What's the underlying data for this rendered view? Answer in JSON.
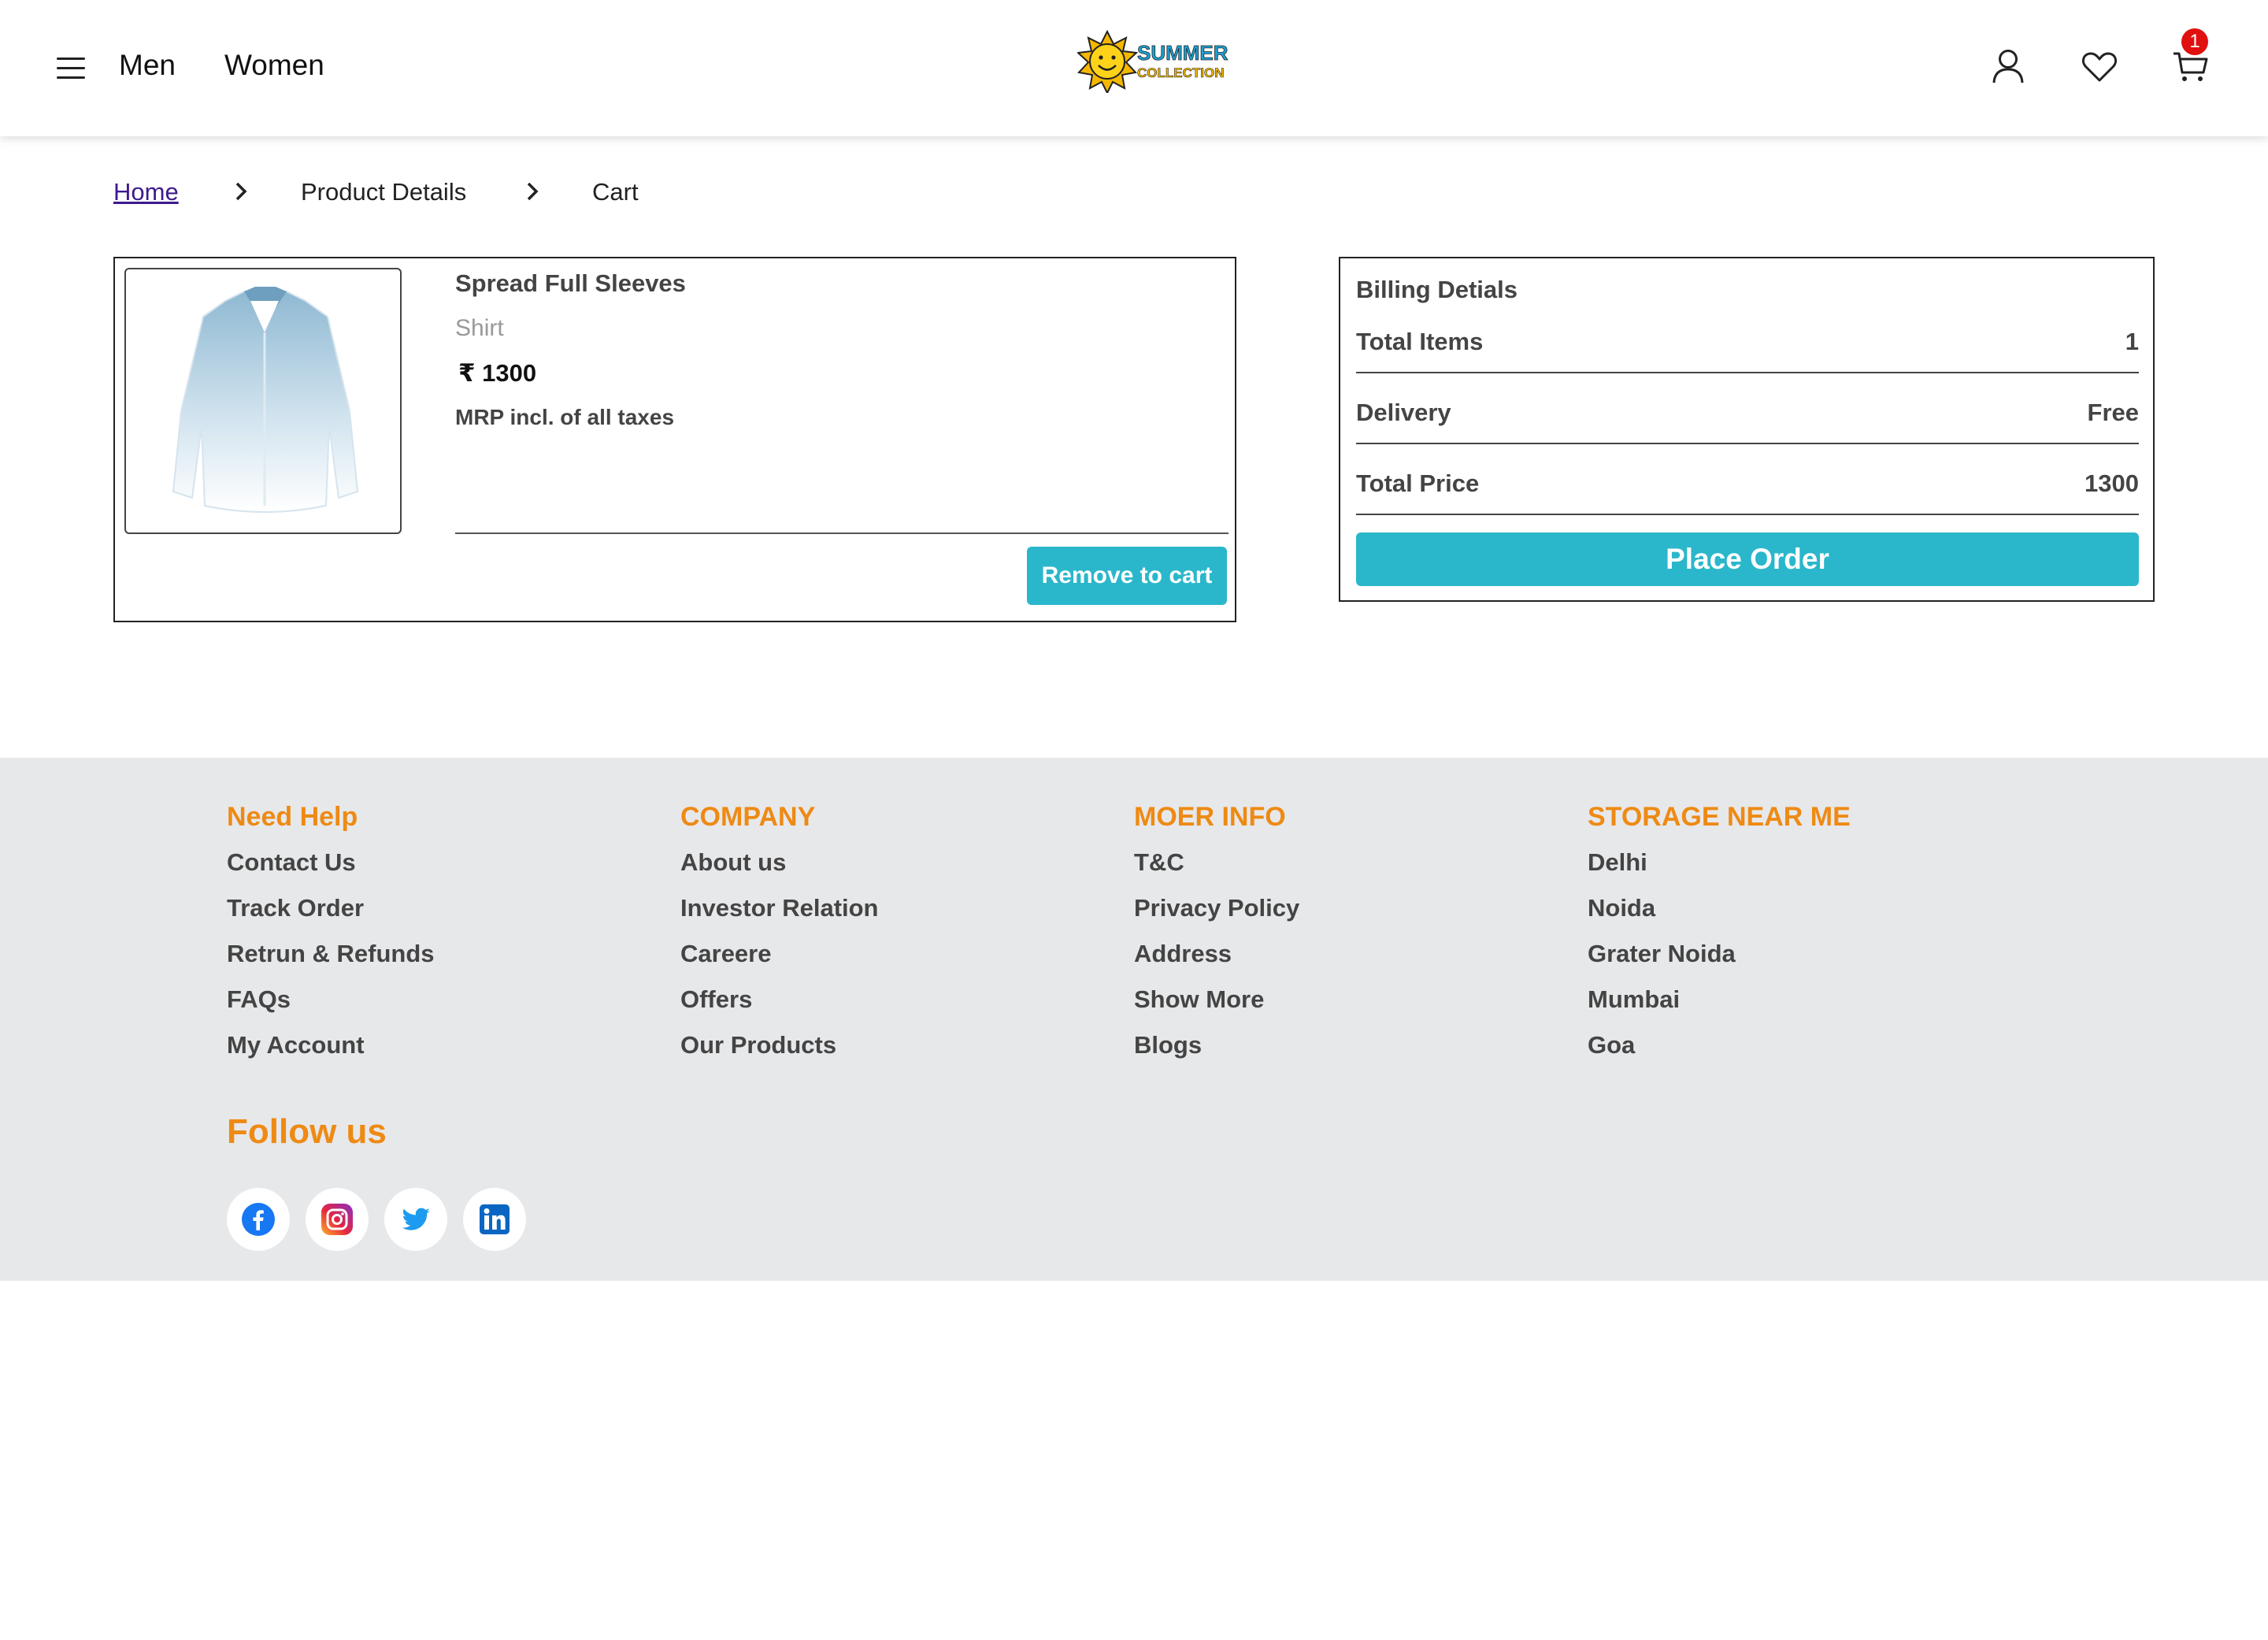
{
  "header": {
    "nav": {
      "men": "Men",
      "women": "Women"
    },
    "logo": {
      "line1": "SUMMER",
      "line2": "COLLECTION"
    },
    "cart_count": "1"
  },
  "breadcrumb": {
    "home": "Home",
    "product_details": "Product Details",
    "cart": "Cart"
  },
  "cart_item": {
    "name": "Spread Full Sleeves",
    "type": "Shirt",
    "price": "₹ 1300",
    "mrp_note": "MRP incl. of all taxes",
    "remove_label": "Remove to cart"
  },
  "billing": {
    "title": "Billing Detials",
    "rows": [
      {
        "label": "Total Items",
        "value": "1"
      },
      {
        "label": "Delivery",
        "value": "Free"
      },
      {
        "label": "Total Price",
        "value": "1300"
      }
    ],
    "place_order_label": "Place Order"
  },
  "footer": {
    "columns": [
      {
        "heading": "Need Help",
        "links": [
          "Contact Us",
          "Track Order",
          "Retrun & Refunds",
          "FAQs",
          "My Account"
        ]
      },
      {
        "heading": "COMPANY",
        "links": [
          "About us",
          "Investor Relation",
          "Careere",
          "Offers",
          "Our Products"
        ]
      },
      {
        "heading": "MOER INFO",
        "links": [
          "T&C",
          "Privacy Policy",
          "Address",
          "Show More",
          "Blogs"
        ]
      },
      {
        "heading": "STORAGE NEAR ME",
        "links": [
          "Delhi",
          "Noida",
          "Grater Noida",
          "Mumbai",
          "Goa"
        ]
      }
    ],
    "follow_title": "Follow us",
    "social": [
      "facebook-icon",
      "instagram-icon",
      "twitter-icon",
      "linkedin-icon"
    ]
  },
  "colors": {
    "accent": "#2bb7cb",
    "footer_heading": "#ee8a14",
    "badge": "#e0100f",
    "footer_bg": "#e7e8ea"
  }
}
